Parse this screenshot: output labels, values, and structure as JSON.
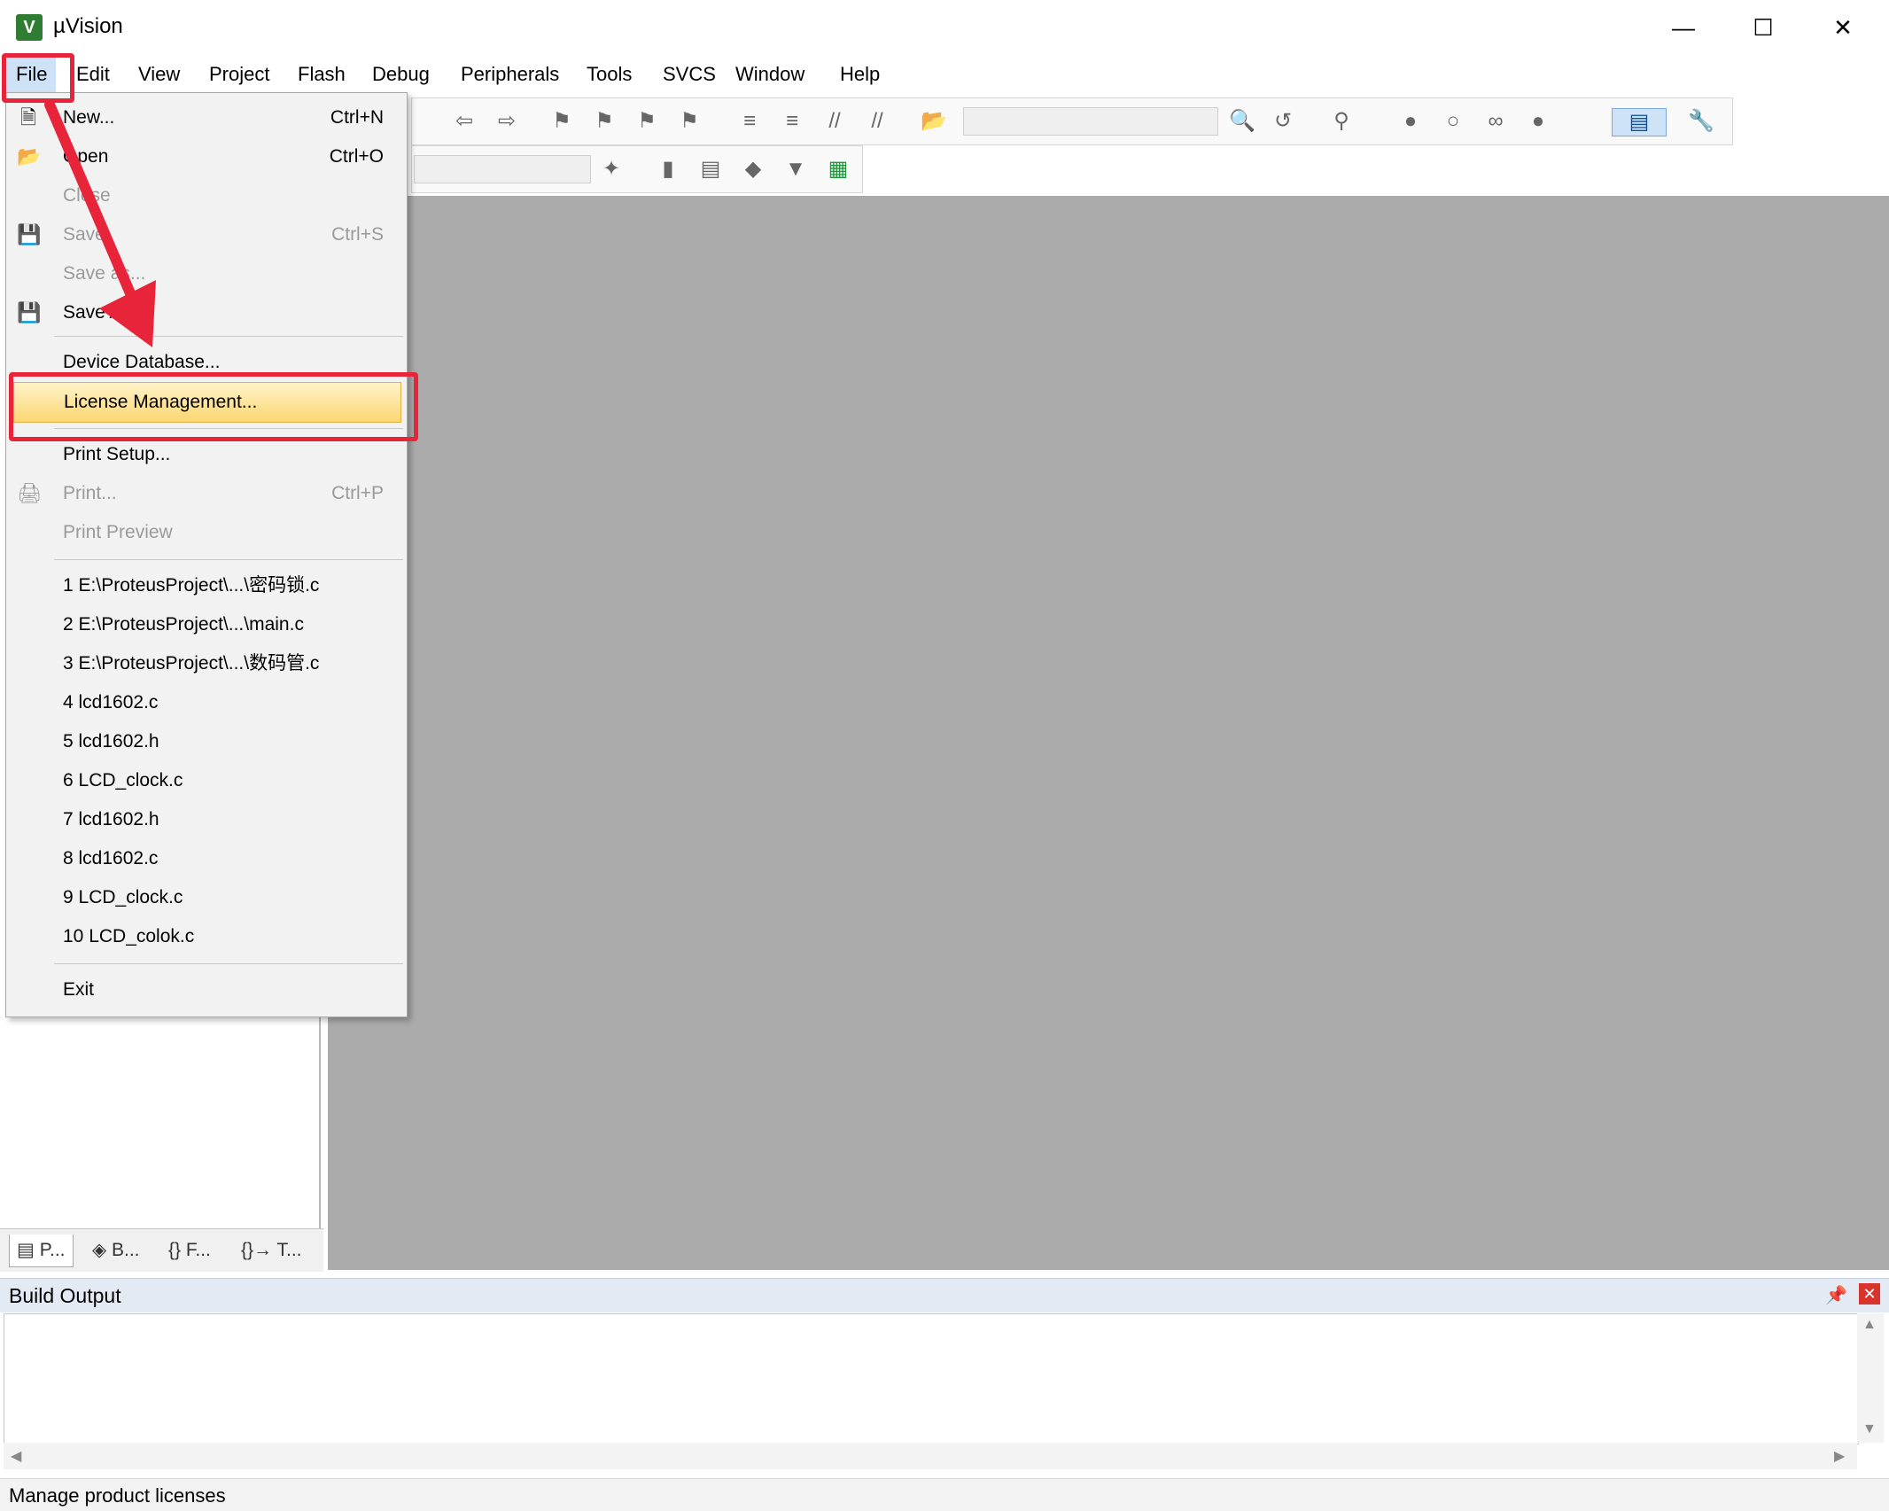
{
  "window": {
    "title": "µVision",
    "icon": "uvision-logo-icon",
    "controls": [
      "minimize-icon",
      "maximize-icon",
      "close-icon"
    ]
  },
  "menubar": [
    "File",
    "Edit",
    "View",
    "Project",
    "Flash",
    "Debug",
    "Peripherals",
    "Tools",
    "SVCS",
    "Window",
    "Help"
  ],
  "file_menu": {
    "new": {
      "label": "New...",
      "shortcut": "Ctrl+N"
    },
    "open": {
      "label": "Open",
      "shortcut": "Ctrl+O"
    },
    "close": {
      "label": "Close"
    },
    "save": {
      "label": "Save",
      "shortcut": "Ctrl+S"
    },
    "save_as": {
      "label": "Save as..."
    },
    "save_all": {
      "label": "Save All"
    },
    "device_database": {
      "label": "Device Database..."
    },
    "license_management": {
      "label": "License Management..."
    },
    "print_setup": {
      "label": "Print Setup..."
    },
    "print": {
      "label": "Print...",
      "shortcut": "Ctrl+P"
    },
    "print_preview": {
      "label": "Print Preview"
    },
    "recent": [
      "1 E:\\ProteusProject\\...\\密码锁.c",
      "2 E:\\ProteusProject\\...\\main.c",
      "3 E:\\ProteusProject\\...\\数码管.c",
      "4 lcd1602.c",
      "5 lcd1602.h",
      "6 LCD_clock.c",
      "7 lcd1602.h",
      "8 lcd1602.c",
      "9 LCD_clock.c",
      "10 LCD_colok.c"
    ],
    "exit": {
      "label": "Exit"
    }
  },
  "project_tabs": [
    "P...",
    "B...",
    "F...",
    "T..."
  ],
  "build_output": {
    "title": "Build Output"
  },
  "status": {
    "text": "Manage product licenses"
  },
  "colors": {
    "annotation": "#e8243a",
    "highlight": "#fcd772",
    "workspace": "#ababab"
  }
}
